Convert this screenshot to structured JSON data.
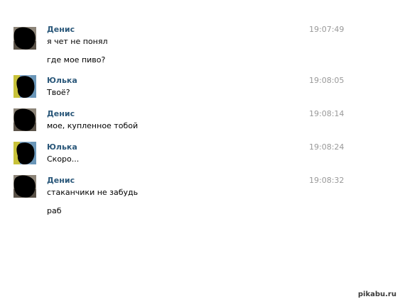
{
  "messages": [
    {
      "author": "Денис",
      "time": "19:07:49",
      "lines": [
        "я чет не понял",
        "где мое пиво?"
      ],
      "avatar": "denis"
    },
    {
      "author": "Юлька",
      "time": "19:08:05",
      "lines": [
        "Твоё?"
      ],
      "avatar": "yulka"
    },
    {
      "author": "Денис",
      "time": "19:08:14",
      "lines": [
        "мое, купленное тобой"
      ],
      "avatar": "denis"
    },
    {
      "author": "Юлька",
      "time": "19:08:24",
      "lines": [
        "Скоро..."
      ],
      "avatar": "yulka"
    },
    {
      "author": "Денис",
      "time": "19:08:32",
      "lines": [
        "стаканчики не забудь",
        "раб"
      ],
      "avatar": "denis"
    }
  ],
  "watermark": "pikabu.ru",
  "colors": {
    "author": "#2b587a",
    "time": "#999999",
    "text": "#000000",
    "background": "#ffffff"
  }
}
